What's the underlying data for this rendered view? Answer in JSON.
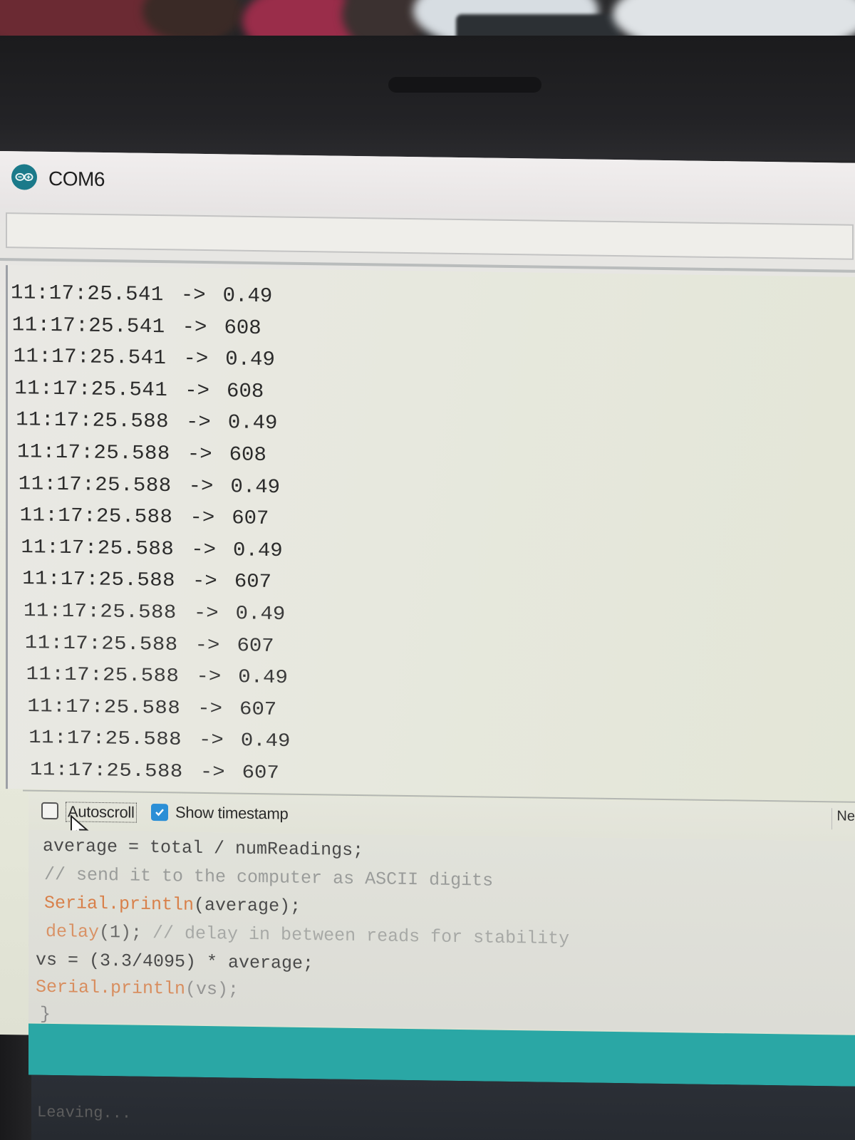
{
  "window": {
    "title": "COM6",
    "accent_color": "#1b7a8a",
    "icon": "arduino-icon"
  },
  "serial_input": {
    "value": ""
  },
  "log_lines": [
    {
      "time": "11:17:25.541",
      "arrow": "->",
      "value": "0.49"
    },
    {
      "time": "11:17:25.541",
      "arrow": "->",
      "value": "608"
    },
    {
      "time": "11:17:25.541",
      "arrow": "->",
      "value": "0.49"
    },
    {
      "time": "11:17:25.541",
      "arrow": "->",
      "value": "608"
    },
    {
      "time": "11:17:25.588",
      "arrow": "->",
      "value": "0.49"
    },
    {
      "time": "11:17:25.588",
      "arrow": "->",
      "value": "608"
    },
    {
      "time": "11:17:25.588",
      "arrow": "->",
      "value": "0.49"
    },
    {
      "time": "11:17:25.588",
      "arrow": "->",
      "value": "607"
    },
    {
      "time": "11:17:25.588",
      "arrow": "->",
      "value": "0.49"
    },
    {
      "time": "11:17:25.588",
      "arrow": "->",
      "value": "607"
    },
    {
      "time": "11:17:25.588",
      "arrow": "->",
      "value": "0.49"
    },
    {
      "time": "11:17:25.588",
      "arrow": "->",
      "value": "607"
    },
    {
      "time": "11:17:25.588",
      "arrow": "->",
      "value": "0.49"
    },
    {
      "time": "11:17:25.588",
      "arrow": "->",
      "value": "607"
    },
    {
      "time": "11:17:25.588",
      "arrow": "->",
      "value": "0.49"
    },
    {
      "time": "11:17:25.588",
      "arrow": "->",
      "value": "607"
    }
  ],
  "controls": {
    "autoscroll_label": "Autoscroll",
    "autoscroll_checked": false,
    "timestamp_label": "Show timestamp",
    "timestamp_checked": true,
    "checkbox_color": "#2b8fd6",
    "line_ending_label": "Ne"
  },
  "code": {
    "line1": {
      "a": "average = total / numReadings;"
    },
    "line2": {
      "a": "// send it to the computer as ASCII digits"
    },
    "line3": {
      "a": "Serial.println",
      "b": "(average);"
    },
    "line4": {
      "a": "delay",
      "b": "(1); ",
      "c": "// delay in between reads for stability"
    },
    "line5": {
      "a": "vs = (3.3/4095) * average;"
    },
    "line6": {
      "a": "Serial.println",
      "b": "(vs);"
    },
    "line7": {
      "a": "}"
    }
  },
  "status_bar_color": "#2aa7a5",
  "console": {
    "text": "Leaving..."
  }
}
